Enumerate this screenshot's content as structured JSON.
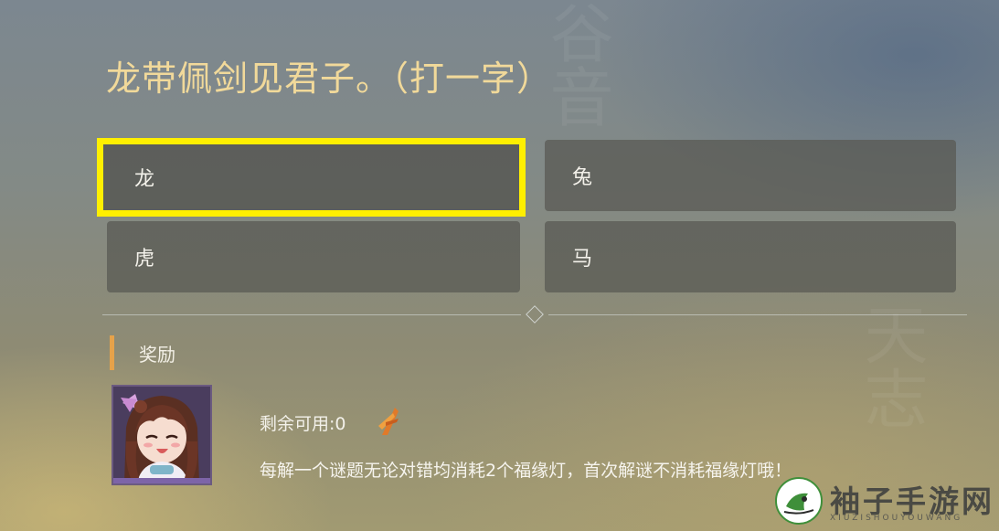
{
  "riddle": {
    "question": "龙带佩剑见君子。（打一字）"
  },
  "options": [
    {
      "label": "龙",
      "selected": true
    },
    {
      "label": "兔",
      "selected": false
    },
    {
      "label": "虎",
      "selected": false
    },
    {
      "label": "马",
      "selected": false
    }
  ],
  "reward": {
    "section_title": "奖励",
    "remaining_text": "剩余可用:0",
    "tip_text": "每解一个谜题无论对错均消耗2个福缘灯，首次解谜不消耗福缘灯哦！",
    "icon": "lantern-icon"
  },
  "watermark": {
    "text": "袖子手游网",
    "sub": "XIUZISHOUYOUWANG"
  },
  "colors": {
    "title": "#f1d99a",
    "selected_border": "#ffef00",
    "accent": "#e6a24a"
  }
}
